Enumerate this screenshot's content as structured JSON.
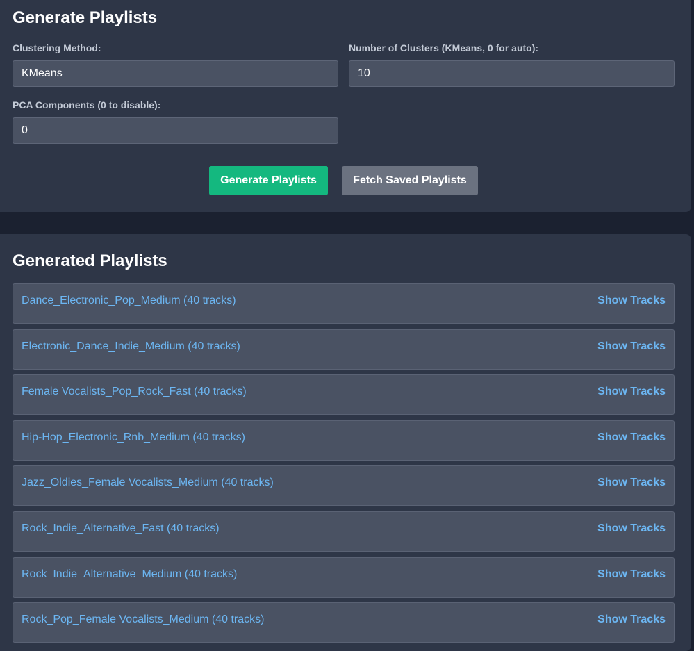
{
  "generate_section": {
    "title": "Generate Playlists",
    "clustering_method": {
      "label": "Clustering Method:",
      "value": "KMeans"
    },
    "num_clusters": {
      "label": "Number of Clusters (KMeans, 0 for auto):",
      "value": "10"
    },
    "pca_components": {
      "label": "PCA Components (0 to disable):",
      "value": "0"
    },
    "generate_button": "Generate Playlists",
    "fetch_button": "Fetch Saved Playlists"
  },
  "playlists_section": {
    "title": "Generated Playlists",
    "show_tracks_label": "Show Tracks",
    "items": [
      {
        "name": "Dance_Electronic_Pop_Medium (40 tracks)"
      },
      {
        "name": "Electronic_Dance_Indie_Medium (40 tracks)"
      },
      {
        "name": "Female Vocalists_Pop_Rock_Fast (40 tracks)"
      },
      {
        "name": "Hip-Hop_Electronic_Rnb_Medium (40 tracks)"
      },
      {
        "name": "Jazz_Oldies_Female Vocalists_Medium (40 tracks)"
      },
      {
        "name": "Rock_Indie_Alternative_Fast (40 tracks)"
      },
      {
        "name": "Rock_Indie_Alternative_Medium (40 tracks)"
      },
      {
        "name": "Rock_Pop_Female Vocalists_Medium (40 tracks)"
      }
    ]
  },
  "colors": {
    "page_background": "#1b2130",
    "panel_background": "#2e3647",
    "input_background": "#4a5263",
    "link_blue": "#6cb6f2",
    "generate_green": "#14b87f",
    "fetch_gray": "#6b7280"
  }
}
